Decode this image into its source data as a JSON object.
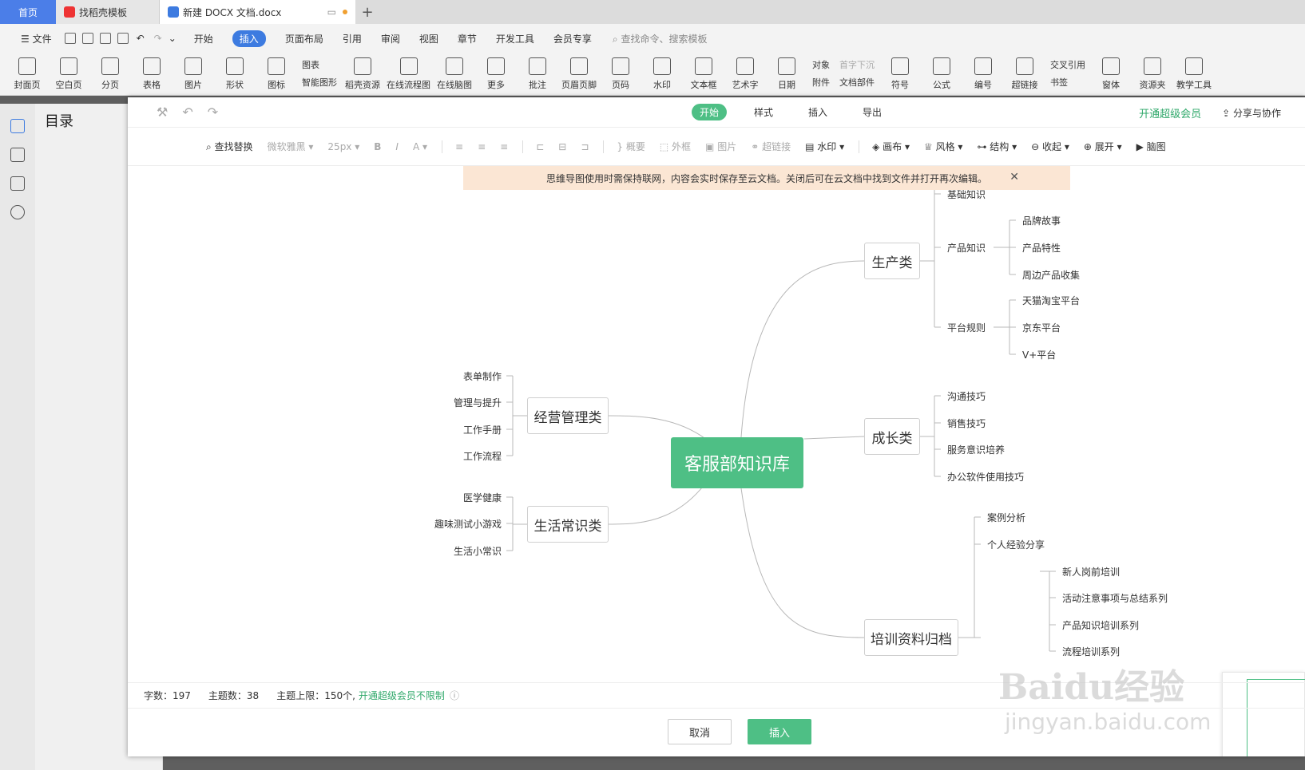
{
  "tabs": {
    "home": "首页",
    "template": "找稻壳模板",
    "doc": "新建 DOCX 文档.docx"
  },
  "menu": {
    "file": "文件",
    "items": [
      "开始",
      "插入",
      "页面布局",
      "引用",
      "审阅",
      "视图",
      "章节",
      "开发工具",
      "会员专享"
    ],
    "active": "插入",
    "search": "查找命令、搜索模板"
  },
  "ribbon": {
    "buttons": [
      "封面页",
      "空白页",
      "分页",
      "表格",
      "图片",
      "形状",
      "图标"
    ],
    "chart": "图表",
    "smart": "智能图形",
    "buttons2": [
      "稻壳资源",
      "在线流程图",
      "在线脑图",
      "更多",
      "批注",
      "页眉页脚",
      "页码",
      "水印",
      "文本框",
      "艺术字",
      "日期"
    ],
    "object": "对象",
    "attach": "附件",
    "dropcap": "首字下沉",
    "docpart": "文档部件",
    "buttons3": [
      "符号",
      "公式",
      "编号",
      "超链接"
    ],
    "crossref": "交叉引用",
    "bookmark": "书签",
    "buttons4": [
      "窗体",
      "资源夹",
      "教学工具"
    ]
  },
  "toc": {
    "title": "目录"
  },
  "dialog": {
    "tabs": [
      "开始",
      "样式",
      "插入",
      "导出"
    ],
    "vip": "开通超级会员",
    "share": "分享与协作",
    "tools": {
      "find": "查找替换",
      "font": "微软雅黑",
      "size": "25px",
      "outline": "概要",
      "frame": "外框",
      "image": "图片",
      "link": "超链接",
      "watermark": "水印",
      "canvas": "画布",
      "style": "风格",
      "structure": "结构",
      "collapse": "收起",
      "expand": "展开",
      "slides": "脑图"
    },
    "notice": "思维导图使用时需保持联网，内容会实时保存至云文档。关闭后可在云文档中找到文件并打开再次编辑。",
    "status": {
      "words": "字数：197",
      "topics": "主题数：38",
      "limit": "主题上限：150个,",
      "unlimit": "开通超级会员不限制"
    },
    "cancel": "取消",
    "insert": "插入"
  },
  "mindmap": {
    "root": "客服部知识库",
    "left": [
      {
        "label": "经营管理类",
        "children": [
          "表单制作",
          "管理与提升",
          "工作手册",
          "工作流程"
        ]
      },
      {
        "label": "生活常识类",
        "children": [
          "医学健康",
          "趣味测试小游戏",
          "生活小常识"
        ]
      }
    ],
    "right": [
      {
        "label": "生产类",
        "children": [
          {
            "label": "基础知识"
          },
          {
            "label": "产品知识",
            "children": [
              "品牌故事",
              "产品特性",
              "周边产品收集"
            ]
          },
          {
            "label": "平台规则",
            "children": [
              "天猫淘宝平台",
              "京东平台",
              "V+平台"
            ]
          }
        ]
      },
      {
        "label": "成长类",
        "children": [
          "沟通技巧",
          "销售技巧",
          "服务意识培养",
          "办公软件使用技巧"
        ]
      },
      {
        "label": "培训资料归档",
        "children": [
          "案例分析",
          "个人经验分享",
          "新人岗前培训",
          "活动注意事项与总结系列",
          "产品知识培训系列",
          "流程培训系列"
        ]
      }
    ]
  },
  "watermark": {
    "line1": "Baidu经验",
    "line2": "jingyan.baidu.com"
  },
  "colors": {
    "accent": "#4ebf85",
    "blue": "#3d7be0"
  }
}
